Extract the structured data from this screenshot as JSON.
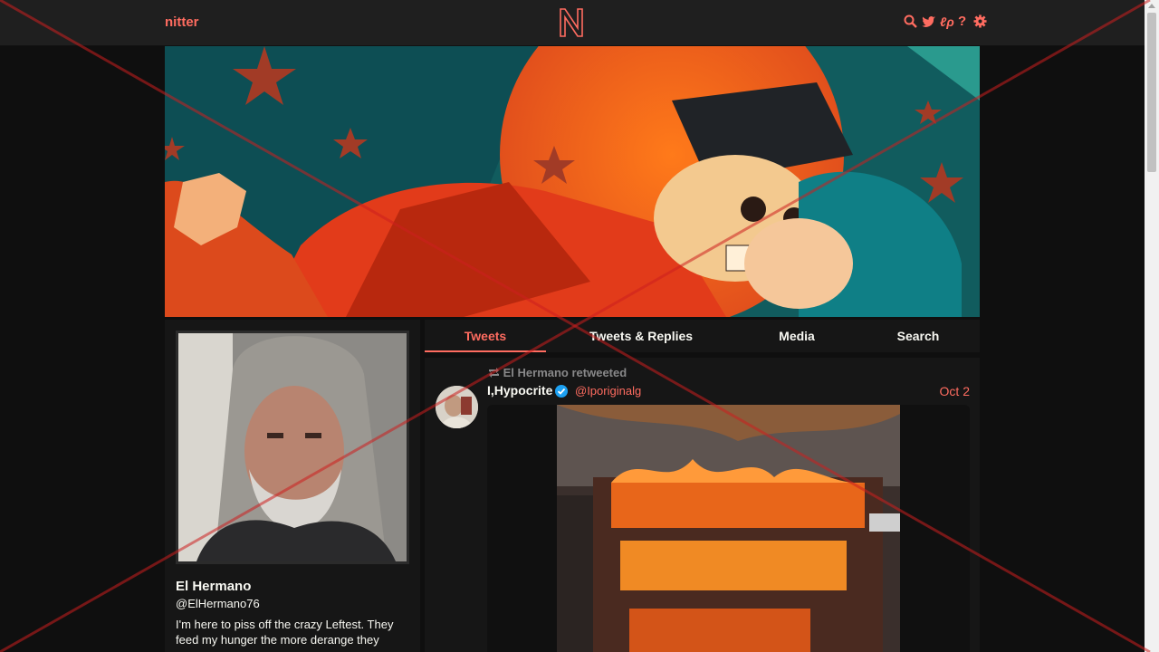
{
  "navbar": {
    "brand": "nitter",
    "logo_letter": "N",
    "icons": [
      "search-icon",
      "twitter-icon",
      "rss-icon",
      "about-icon",
      "settings-icon"
    ],
    "rss_glyph": "ℓρ",
    "about_glyph": "?"
  },
  "profile": {
    "fullname": "El Hermano",
    "username": "@ElHermano76",
    "bio": "I'm here to piss off the crazy Leftest. They feed my hunger the more derange they"
  },
  "tabs": [
    {
      "label": "Tweets",
      "active": true
    },
    {
      "label": "Tweets & Replies",
      "active": false
    },
    {
      "label": "Media",
      "active": false
    },
    {
      "label": "Search",
      "active": false
    }
  ],
  "tweet": {
    "retweet_header": "El Hermano retweeted",
    "fullname": "I,Hypocrite",
    "username": "@Iporiginalg",
    "date": "Oct 2",
    "verified": true
  },
  "colors": {
    "accent": "#ff6c60",
    "background": "#0f0f0f",
    "panel": "#161616",
    "navbar": "#1f1f1f",
    "muted": "#888889",
    "overlay_cross": "#cc1f1f"
  }
}
